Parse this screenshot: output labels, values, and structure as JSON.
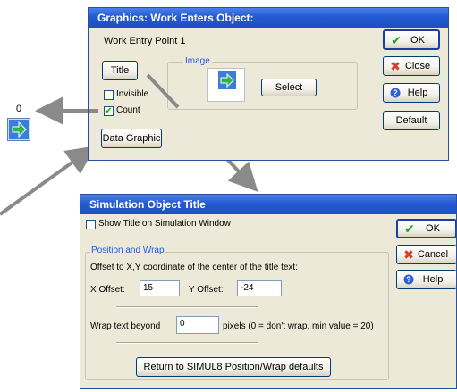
{
  "graphics_dialog": {
    "title": "Graphics: Work Enters Object:",
    "object_name": "Work Entry Point 1",
    "image_group_label": "Image",
    "title_button": "Title",
    "invisible_label": "Invisible",
    "invisible_checked": false,
    "count_label": "Count",
    "count_checked": true,
    "data_graphic_button": "Data Graphic",
    "select_button": "Select",
    "ok_button": "OK",
    "close_button": "Close",
    "help_button": "Help",
    "default_button": "Default"
  },
  "canvas_object": {
    "count_value": "0",
    "icon": "green-right-arrow-icon"
  },
  "title_dialog": {
    "title": "Simulation Object Title",
    "show_title_label": "Show Title on Simulation Window",
    "show_title_checked": false,
    "position_group_label": "Position and Wrap",
    "offset_description": "Offset to X,Y coordinate of the center of the title text:",
    "x_offset_label": "X Offset:",
    "x_offset_value": "15",
    "y_offset_label": "Y Offset:",
    "y_offset_value": "-24",
    "wrap_label": "Wrap text beyond",
    "wrap_value": "0",
    "wrap_suffix": "pixels (0 = don't wrap, min value = 20)",
    "return_button": "Return to SIMUL8 Position/Wrap defaults",
    "ok_button": "OK",
    "cancel_button": "Cancel",
    "help_button": "Help"
  },
  "colors": {
    "title_bar": "#2459d4",
    "arrow_gray": "#8a8a8a",
    "check_green": "#21a121",
    "close_red": "#d93b2b",
    "help_blue": "#2e5fd9"
  }
}
